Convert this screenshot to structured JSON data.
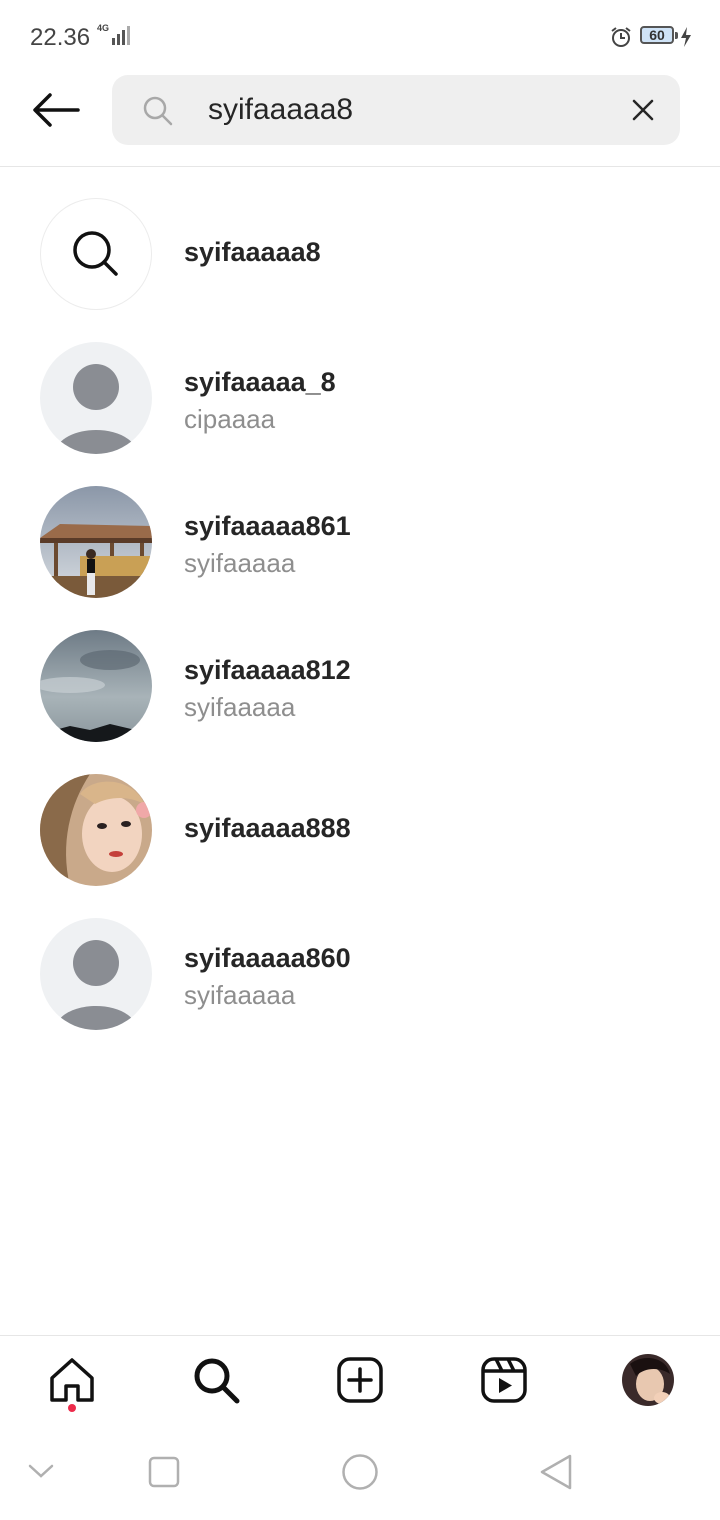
{
  "status_bar": {
    "time": "22.36",
    "network": "4G",
    "battery": "60"
  },
  "search": {
    "query": "syifaaaaa8",
    "icon": "search-icon",
    "clear_icon": "close-icon",
    "back_icon": "back-arrow-icon"
  },
  "results": [
    {
      "type": "keyword",
      "username": "syifaaaaa8",
      "fullname": ""
    },
    {
      "type": "account",
      "username": "syifaaaaa_8",
      "fullname": "cipaaaa",
      "avatar": "default-avatar"
    },
    {
      "type": "account",
      "username": "syifaaaaa861",
      "fullname": "syifaaaaa",
      "avatar": "photo-beach-hut"
    },
    {
      "type": "account",
      "username": "syifaaaaa812",
      "fullname": "syifaaaaa",
      "avatar": "photo-cloudy-sky"
    },
    {
      "type": "account",
      "username": "syifaaaaa888",
      "fullname": "",
      "avatar": "photo-selfie"
    },
    {
      "type": "account",
      "username": "syifaaaaa860",
      "fullname": "syifaaaaa",
      "avatar": "default-avatar"
    }
  ],
  "bottom_nav": {
    "items": [
      "home-icon",
      "search-icon",
      "create-post-icon",
      "reels-icon",
      "profile-avatar"
    ],
    "active": "search-icon",
    "notification_color": "#ed2b4b"
  },
  "system_nav": [
    "collapse-chevron-icon",
    "recent-apps-icon",
    "home-circle-icon",
    "back-triangle-icon"
  ],
  "colors": {
    "primary_text": "#262626",
    "secondary_text": "#8e8e8e",
    "search_bg": "#efefef",
    "default_avatar_bg": "#eff1f3",
    "default_avatar_fg": "#8a8d93"
  }
}
